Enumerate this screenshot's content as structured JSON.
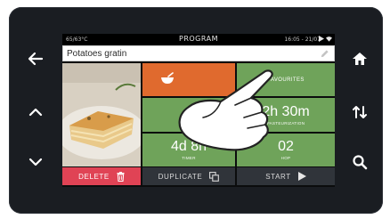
{
  "status_bar": {
    "temperature": "65/63°C",
    "title": "PROGRAM",
    "datetime": "16:05 - 21/07",
    "indicators": [
      "play-icon",
      "wifi-icon"
    ]
  },
  "program_name": {
    "value": "Potatoes gratin",
    "edit_icon": "pencil-icon"
  },
  "tiles": {
    "category_icon": "bowl-icon",
    "favourites_label": "FAVOURITES",
    "pasteurization_value": "2h 30m",
    "pasteurization_label": "PASTEURIZATION",
    "timer_value": "4d 8h",
    "timer_label": "TIMER",
    "hop_value": "02",
    "hop_label": "HOP"
  },
  "buttons": {
    "delete_label": "DELETE",
    "duplicate_label": "DUPLICATE",
    "start_label": "START"
  },
  "side_buttons": {
    "left": [
      "back-arrow-icon",
      "chevron-up-icon",
      "chevron-down-icon"
    ],
    "right": [
      "home-icon",
      "swap-arrows-icon",
      "search-icon"
    ]
  },
  "colors": {
    "tile_green": "#6fa35a",
    "tile_orange": "#e06a2e",
    "delete_red": "#e04355",
    "bezel": "#1a1d22"
  }
}
